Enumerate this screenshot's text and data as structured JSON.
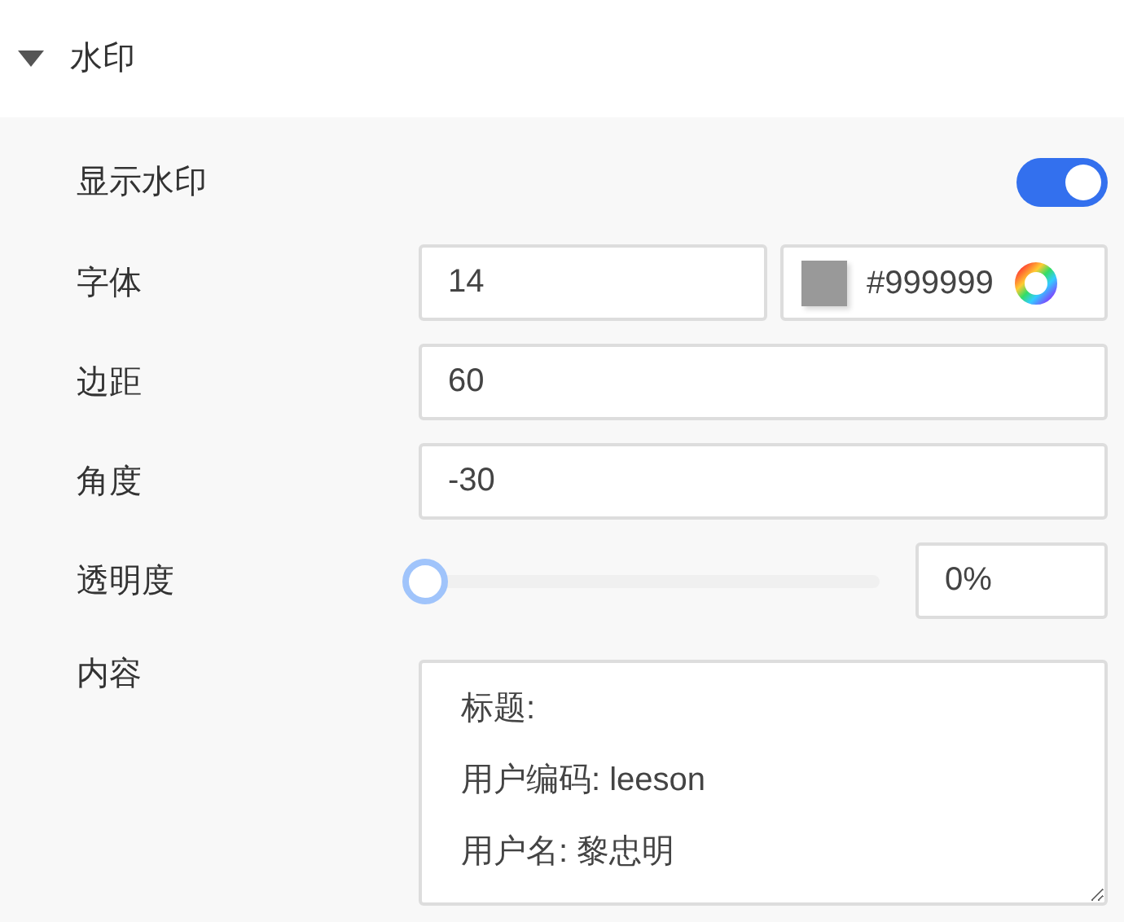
{
  "section": {
    "title": "水印",
    "expanded": true
  },
  "show_watermark": {
    "label": "显示水印",
    "on": true
  },
  "font": {
    "label": "字体",
    "size": "14",
    "color": "#999999"
  },
  "margin": {
    "label": "边距",
    "value": "60"
  },
  "angle": {
    "label": "角度",
    "value": "-30"
  },
  "opacity": {
    "label": "透明度",
    "level": 0,
    "value": "0%"
  },
  "content": {
    "label": "内容",
    "lines": [
      "标题:",
      "用户编码: leeson",
      "用户名: 黎忠明"
    ]
  }
}
